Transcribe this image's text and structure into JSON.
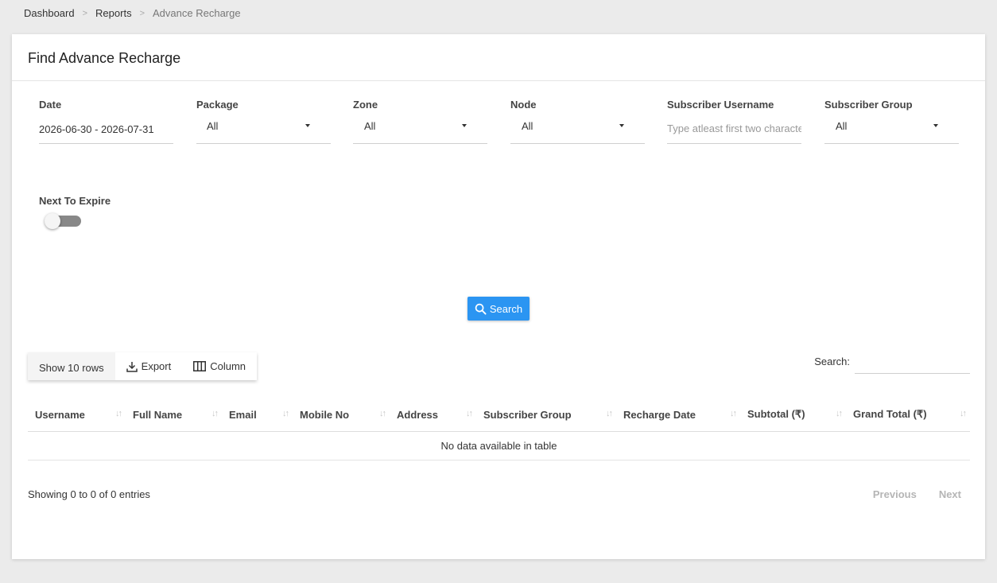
{
  "breadcrumb": [
    {
      "label": "Dashboard"
    },
    {
      "label": "Reports"
    },
    {
      "label": "Advance Recharge"
    }
  ],
  "breadcrumb_separator": ">",
  "card": {
    "title": "Find Advance Recharge"
  },
  "filters": {
    "date": {
      "label": "Date",
      "value": "2026-06-30 - 2026-07-31"
    },
    "package": {
      "label": "Package",
      "value": "All"
    },
    "zone": {
      "label": "Zone",
      "value": "All"
    },
    "node": {
      "label": "Node",
      "value": "All"
    },
    "subscriber_username": {
      "label": "Subscriber Username",
      "placeholder": "Type atleast first two characters"
    },
    "subscriber_group": {
      "label": "Subscriber Group",
      "value": "All"
    },
    "next_to_expire": {
      "label": "Next To Expire",
      "enabled": false
    }
  },
  "search_button": {
    "label": "Search",
    "icon": "search-icon"
  },
  "table_tools": {
    "show_rows": "Show 10 rows",
    "export": "Export",
    "column": "Column",
    "search_label": "Search:"
  },
  "table": {
    "columns": [
      "Username",
      "Full Name",
      "Email",
      "Mobile No",
      "Address",
      "Subscriber Group",
      "Recharge Date",
      "Subtotal (₹)",
      "Grand Total (₹)"
    ],
    "empty_message": "No data available in table"
  },
  "footer": {
    "info": "Showing 0 to 0 of 0 entries",
    "previous": "Previous",
    "next": "Next"
  },
  "colors": {
    "accent": "#2b95f2",
    "background": "#ebebeb"
  }
}
